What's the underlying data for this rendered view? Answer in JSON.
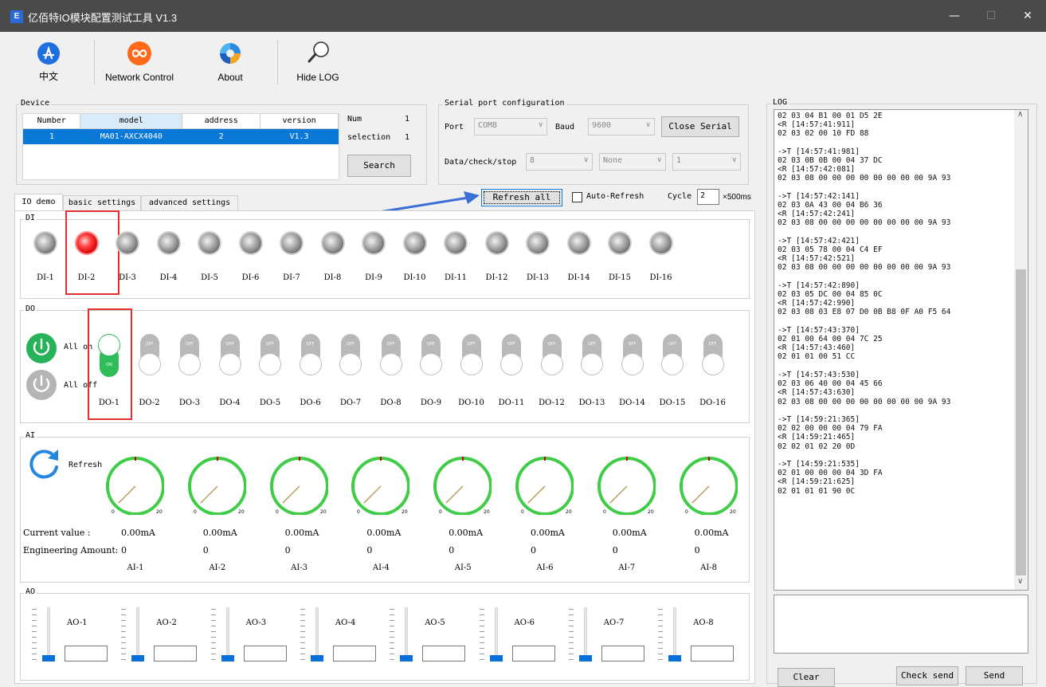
{
  "window": {
    "app_icon_text": "E",
    "title": "亿佰特IO模块配置测试工具 V1.3",
    "minimize": "—",
    "maximize": "☐",
    "close": "✕"
  },
  "toolbar": {
    "language_label": "中文",
    "network_label": "Network Control",
    "about_label": "About",
    "hide_log_label": "Hide LOG"
  },
  "device": {
    "group_title": "Device",
    "columns": [
      "Number",
      "model",
      "address",
      "version"
    ],
    "rows": [
      [
        "1",
        "MA01-AXCX4040",
        "2",
        "V1.3"
      ]
    ],
    "num_label": "Num",
    "num_value": "1",
    "selection_label": "selection",
    "selection_value": "1",
    "search_label": "Search"
  },
  "serial": {
    "group_title": "Serial port configuration",
    "port_label": "Port",
    "port_value": "COM8",
    "baud_label": "Baud",
    "baud_value": "9600",
    "close_label": "Close Serial",
    "dcs_label": "Data/check/stop",
    "data_bits": "8",
    "check": "None",
    "stop_bits": "1"
  },
  "tabs": [
    "IO demo",
    "basic settings",
    "advanced settings"
  ],
  "refresh_bar": {
    "refresh_all_label": "Refresh all",
    "auto_refresh_label": "Auto-Refresh",
    "cycle_label": "Cycle",
    "cycle_value": "2",
    "cycle_unit": "×500ms"
  },
  "di": {
    "group_title": "DI",
    "items": [
      {
        "label": "DI-1",
        "on": false
      },
      {
        "label": "DI-2",
        "on": true
      },
      {
        "label": "DI-3",
        "on": false
      },
      {
        "label": "DI-4",
        "on": false
      },
      {
        "label": "DI-5",
        "on": false
      },
      {
        "label": "DI-6",
        "on": false
      },
      {
        "label": "DI-7",
        "on": false
      },
      {
        "label": "DI-8",
        "on": false
      },
      {
        "label": "DI-9",
        "on": false
      },
      {
        "label": "DI-10",
        "on": false
      },
      {
        "label": "DI-11",
        "on": false
      },
      {
        "label": "DI-12",
        "on": false
      },
      {
        "label": "DI-13",
        "on": false
      },
      {
        "label": "DI-14",
        "on": false
      },
      {
        "label": "DI-15",
        "on": false
      },
      {
        "label": "DI-16",
        "on": false
      }
    ]
  },
  "do": {
    "group_title": "DO",
    "all_on_label": "All on",
    "all_off_label": "All off",
    "on_text": "ON",
    "off_text": "OFF",
    "items": [
      {
        "label": "DO-1",
        "on": true
      },
      {
        "label": "DO-2",
        "on": false
      },
      {
        "label": "DO-3",
        "on": false
      },
      {
        "label": "DO-4",
        "on": false
      },
      {
        "label": "DO-5",
        "on": false
      },
      {
        "label": "DO-6",
        "on": false
      },
      {
        "label": "DO-7",
        "on": false
      },
      {
        "label": "DO-8",
        "on": false
      },
      {
        "label": "DO-9",
        "on": false
      },
      {
        "label": "DO-10",
        "on": false
      },
      {
        "label": "DO-11",
        "on": false
      },
      {
        "label": "DO-12",
        "on": false
      },
      {
        "label": "DO-13",
        "on": false
      },
      {
        "label": "DO-14",
        "on": false
      },
      {
        "label": "DO-15",
        "on": false
      },
      {
        "label": "DO-16",
        "on": false
      }
    ]
  },
  "ai": {
    "group_title": "AI",
    "refresh_label": "Refresh",
    "current_label": "Current value :",
    "eng_label": "Engineering Amount:",
    "gauge_min": "0",
    "gauge_max": "20",
    "items": [
      {
        "label": "AI-1",
        "current": "0.00mA",
        "eng": "0",
        "value": 0
      },
      {
        "label": "AI-2",
        "current": "0.00mA",
        "eng": "0",
        "value": 0
      },
      {
        "label": "AI-3",
        "current": "0.00mA",
        "eng": "0",
        "value": 0
      },
      {
        "label": "AI-4",
        "current": "0.00mA",
        "eng": "0",
        "value": 0
      },
      {
        "label": "AI-5",
        "current": "0.00mA",
        "eng": "0",
        "value": 0
      },
      {
        "label": "AI-6",
        "current": "0.00mA",
        "eng": "0",
        "value": 0
      },
      {
        "label": "AI-7",
        "current": "0.00mA",
        "eng": "0",
        "value": 0
      },
      {
        "label": "AI-8",
        "current": "0.00mA",
        "eng": "0",
        "value": 0
      }
    ]
  },
  "ao": {
    "group_title": "AO",
    "items": [
      {
        "label": "AO-1",
        "value": 0
      },
      {
        "label": "AO-2",
        "value": 0
      },
      {
        "label": "AO-3",
        "value": 0
      },
      {
        "label": "AO-4",
        "value": 0
      },
      {
        "label": "AO-5",
        "value": 0
      },
      {
        "label": "AO-6",
        "value": 0
      },
      {
        "label": "AO-7",
        "value": 0
      },
      {
        "label": "AO-8",
        "value": 0
      }
    ]
  },
  "log": {
    "group_title": "LOG",
    "lines": [
      "02 03 04 B1 00 01 D5 2E",
      "<R [14:57:41:911]",
      "02 03 02 00 10 FD 88",
      "",
      "->T [14:57:41:981]",
      "02 03 0B 0B 00 04 37 DC",
      "<R [14:57:42:081]",
      "02 03 08 00 00 00 00 00 00 00 00 9A 93",
      "",
      "->T [14:57:42:141]",
      "02 03 0A 43 00 04 B6 36",
      "<R [14:57:42:241]",
      "02 03 08 00 00 00 00 00 00 00 00 9A 93",
      "",
      "->T [14:57:42:421]",
      "02 03 05 78 00 04 C4 EF",
      "<R [14:57:42:521]",
      "02 03 08 00 00 00 00 00 00 00 00 9A 93",
      "",
      "->T [14:57:42:890]",
      "02 03 05 DC 00 04 85 0C",
      "<R [14:57:42:990]",
      "02 03 08 03 E8 07 D0 0B B8 0F A0 F5 64",
      "",
      "->T [14:57:43:370]",
      "02 01 00 64 00 04 7C 25",
      "<R [14:57:43:460]",
      "02 01 01 00 51 CC",
      "",
      "->T [14:57:43:530]",
      "02 03 06 40 00 04 45 66",
      "<R [14:57:43:630]",
      "02 03 08 00 00 00 00 00 00 00 00 9A 93",
      "",
      "->T [14:59:21:365]",
      "02 02 00 00 00 04 79 FA",
      "<R [14:59:21:465]",
      "02 02 01 02 20 0D",
      "",
      "->T [14:59:21:535]",
      "02 01 00 00 00 04 3D FA",
      "<R [14:59:21:625]",
      "02 01 01 01 90 0C"
    ],
    "clear_label": "Clear",
    "check_send_label": "Check send",
    "send_label": "Send"
  }
}
